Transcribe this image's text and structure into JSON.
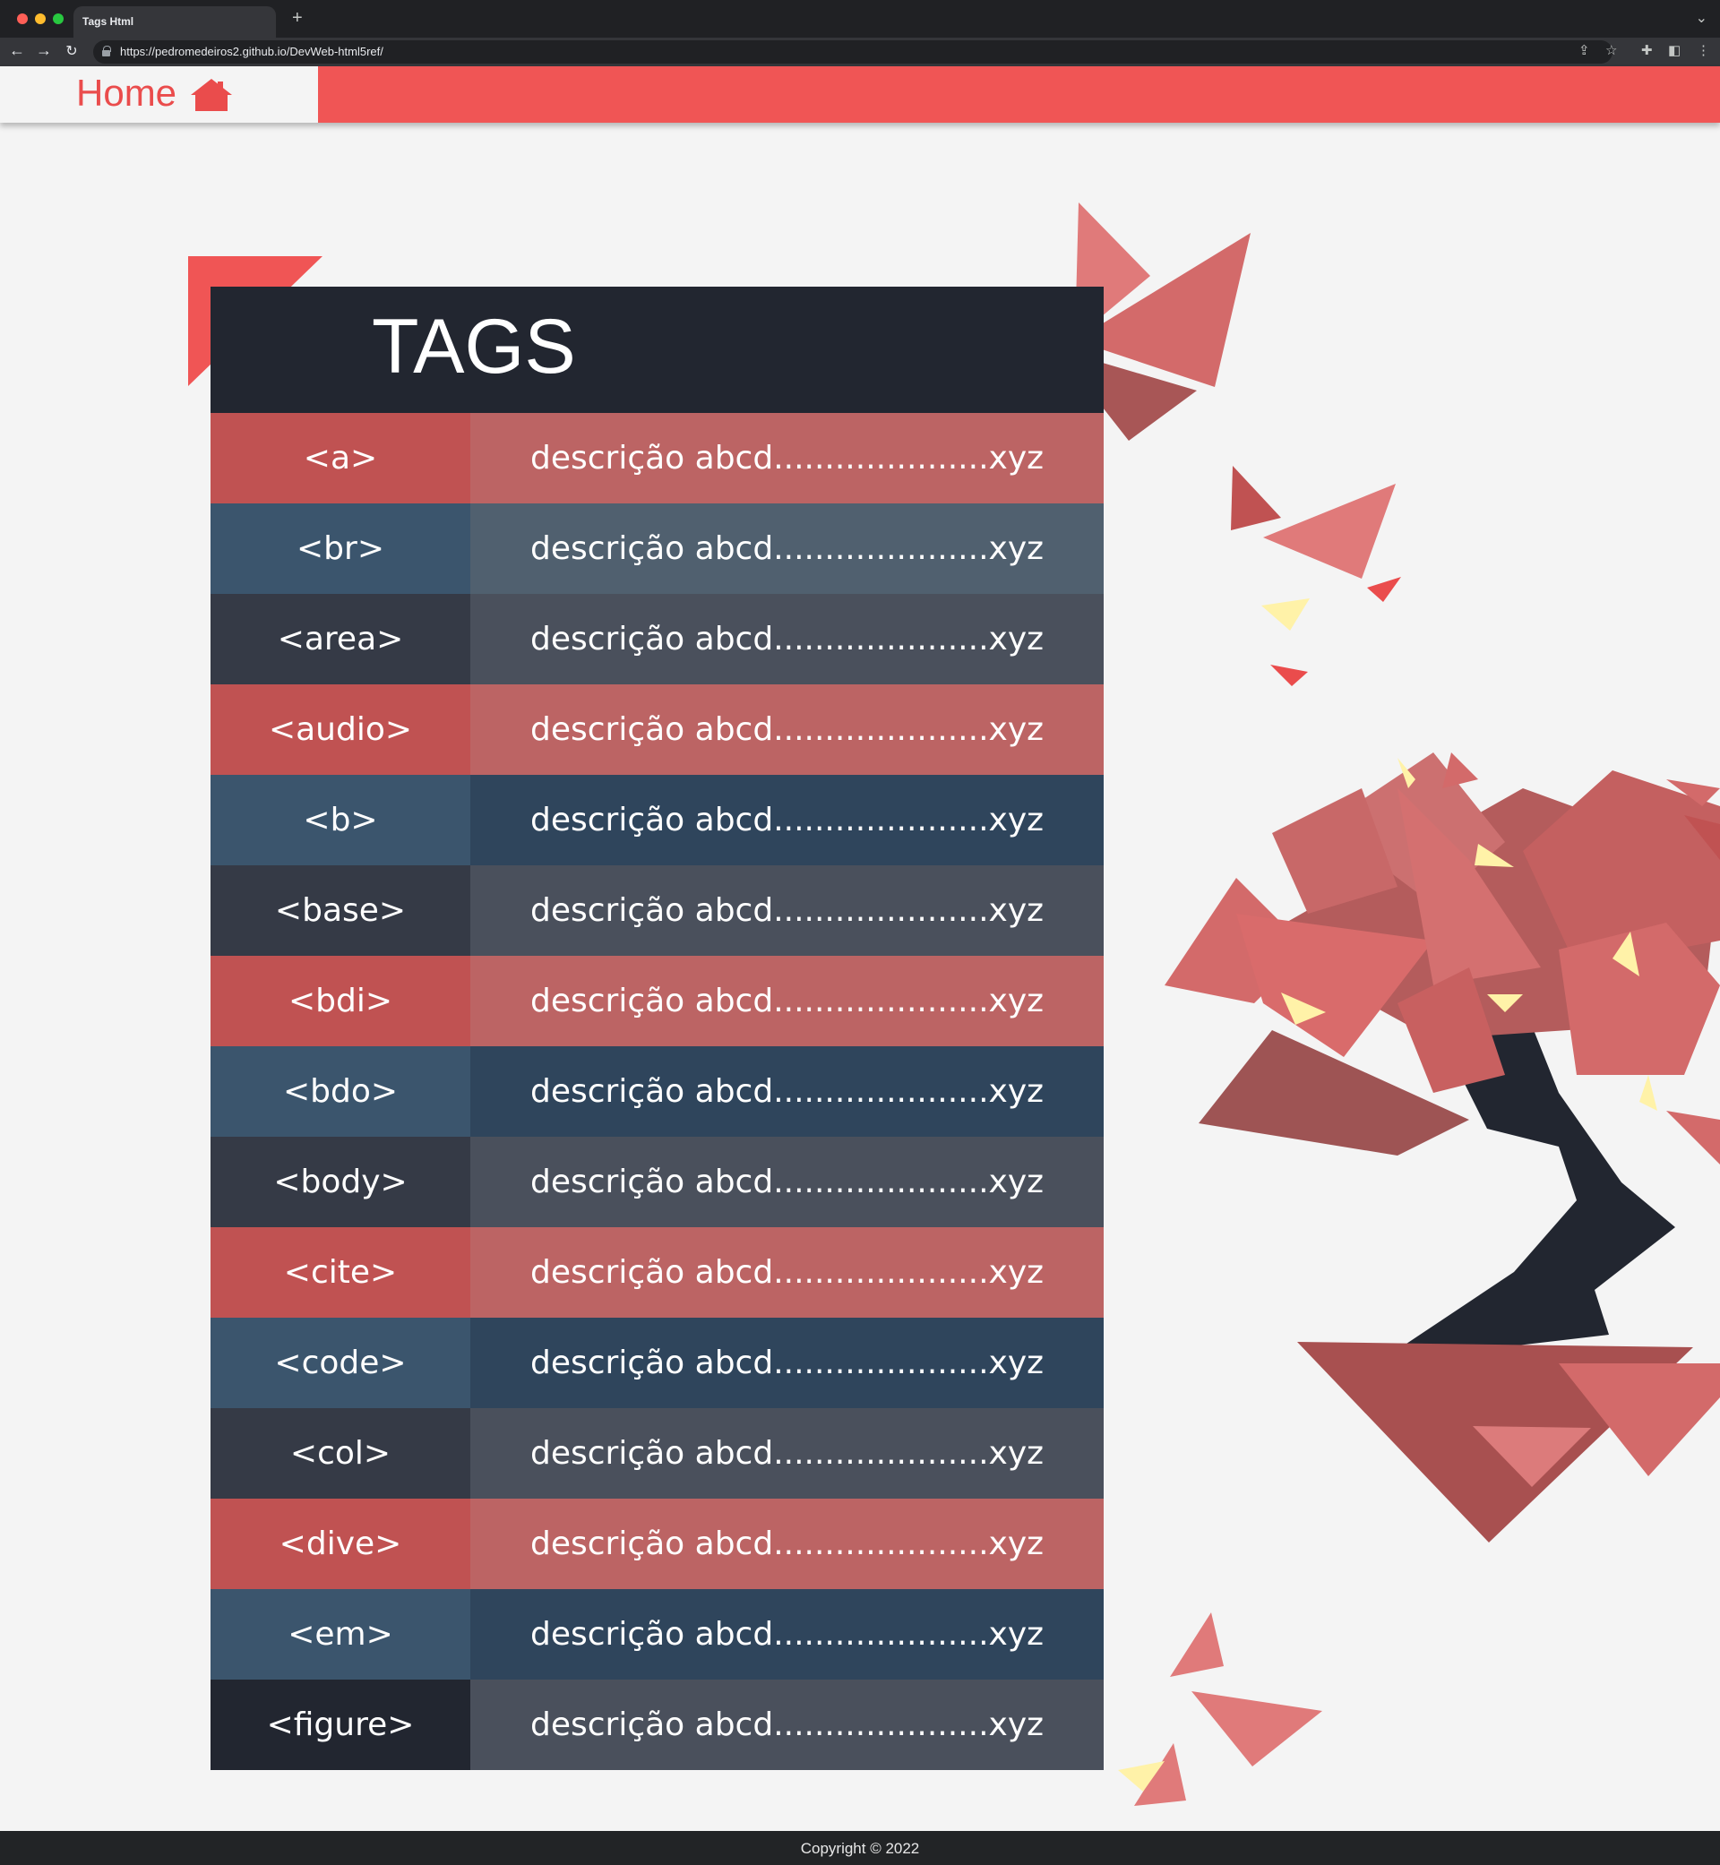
{
  "browser": {
    "tab_title": "Tags Html",
    "new_tab": "+",
    "url": "https://pedromedeiros2.github.io/DevWeb-html5ref/"
  },
  "header": {
    "home_label": "Home",
    "accent": "#f05555"
  },
  "table": {
    "title": "TAGS",
    "rows": [
      {
        "tag": "<a>",
        "desc": "descrição abcd.....................xyz"
      },
      {
        "tag": "<br>",
        "desc": "descrição abcd.....................xyz"
      },
      {
        "tag": "<area>",
        "desc": "descrição abcd.....................xyz"
      },
      {
        "tag": "<audio>",
        "desc": "descrição abcd.....................xyz"
      },
      {
        "tag": "<b>",
        "desc": "descrição abcd.....................xyz"
      },
      {
        "tag": "<base>",
        "desc": "descrição abcd.....................xyz"
      },
      {
        "tag": "<bdi>",
        "desc": "descrição abcd.....................xyz"
      },
      {
        "tag": "<bdo>",
        "desc": "descrição abcd.....................xyz"
      },
      {
        "tag": "<body>",
        "desc": "descrição abcd.....................xyz"
      },
      {
        "tag": "<cite>",
        "desc": "descrição abcd.....................xyz"
      },
      {
        "tag": "<code>",
        "desc": "descrição abcd.....................xyz"
      },
      {
        "tag": "<col>",
        "desc": "descrição abcd.....................xyz"
      },
      {
        "tag": "<dive>",
        "desc": "descrição abcd.....................xyz"
      },
      {
        "tag": "<em>",
        "desc": "descrição abcd.....................xyz"
      },
      {
        "tag": "<figure>",
        "desc": "descrição abcd.....................xyz"
      }
    ]
  },
  "footer": {
    "copyright": "Copyright © 2022"
  },
  "icons": [
    "home-icon",
    "back-icon",
    "forward-icon",
    "reload-icon",
    "lock-icon",
    "share-icon",
    "star-icon",
    "extensions-icon",
    "side-panel-icon",
    "menu-icon"
  ]
}
